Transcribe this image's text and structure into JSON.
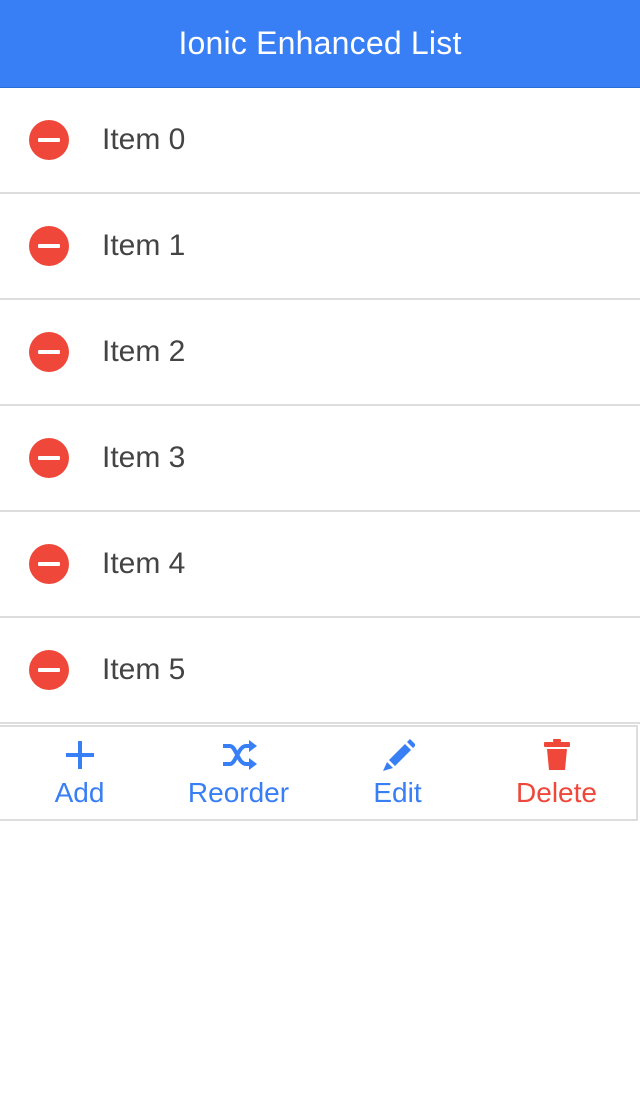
{
  "header": {
    "title": "Ionic Enhanced List"
  },
  "colors": {
    "primary": "#387ef5",
    "danger": "#ef473a",
    "text": "#444444",
    "divider": "#dddddd"
  },
  "list": {
    "items": [
      {
        "label": "Item 0",
        "icon": "minus-circle-icon"
      },
      {
        "label": "Item 1",
        "icon": "minus-circle-icon"
      },
      {
        "label": "Item 2",
        "icon": "minus-circle-icon"
      },
      {
        "label": "Item 3",
        "icon": "minus-circle-icon"
      },
      {
        "label": "Item 4",
        "icon": "minus-circle-icon"
      },
      {
        "label": "Item 5",
        "icon": "minus-circle-icon"
      }
    ]
  },
  "toolbar": {
    "add_label": "Add",
    "add_icon": "plus-icon",
    "reorder_label": "Reorder",
    "reorder_icon": "shuffle-icon",
    "edit_label": "Edit",
    "edit_icon": "pencil-icon",
    "delete_label": "Delete",
    "delete_icon": "trash-icon"
  }
}
